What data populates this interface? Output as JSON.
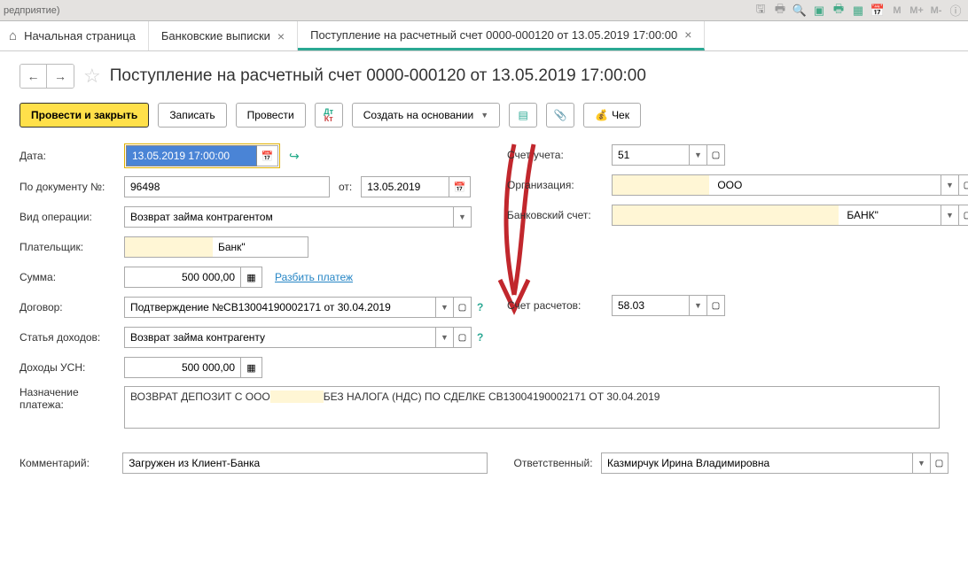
{
  "top_bar": {
    "title_fragment": "редприятие)"
  },
  "tabs": {
    "home": "Начальная страница",
    "tab1": "Банковские выписки",
    "tab2": "Поступление на расчетный счет 0000-000120 от 13.05.2019 17:00:00"
  },
  "header": {
    "title": "Поступление на расчетный счет 0000-000120 от 13.05.2019 17:00:00"
  },
  "toolbar": {
    "post_close": "Провести и закрыть",
    "save": "Записать",
    "post": "Провести",
    "create_based": "Создать на основании",
    "cheque": "Чек"
  },
  "labels": {
    "date": "Дата:",
    "doc_no": "По документу №:",
    "ot": "от:",
    "op_type": "Вид операции:",
    "payer": "Плательщик:",
    "amount": "Сумма:",
    "split": "Разбить платеж",
    "contract": "Договор:",
    "income_item": "Статья доходов:",
    "usn_income": "Доходы УСН:",
    "purpose": "Назначение платежа:",
    "comment": "Комментарий:",
    "account": "Счет учета:",
    "organization": "Организация:",
    "bank_account": "Банковский счет:",
    "settle_account": "Счет расчетов:",
    "responsible": "Ответственный:"
  },
  "values": {
    "datetime": "13.05.2019 17:00:00",
    "doc_no": "96498",
    "doc_date": "13.05.2019",
    "op_type": "Возврат займа контрагентом",
    "payer_text": "Банк\"",
    "amount": "500 000,00",
    "contract": "Подтверждение №СВ13004190002171 от 30.04.2019",
    "income_item": "Возврат займа контрагенту",
    "usn_income": "500 000,00",
    "purpose_pre": "ВОЗВРАТ ДЕПОЗИТ С ООО ",
    "purpose_post": " БЕЗ НАЛОГА (НДС) ПО СДЕЛКЕ СВ13004190002171 ОТ 30.04.2019",
    "comment": "Загружен из Клиент-Банка",
    "account": "51",
    "org_text": " ООО",
    "bank_text": " БАНК\"",
    "settle": "58.03",
    "responsible": "Казмирчук Ирина Владимировна"
  }
}
